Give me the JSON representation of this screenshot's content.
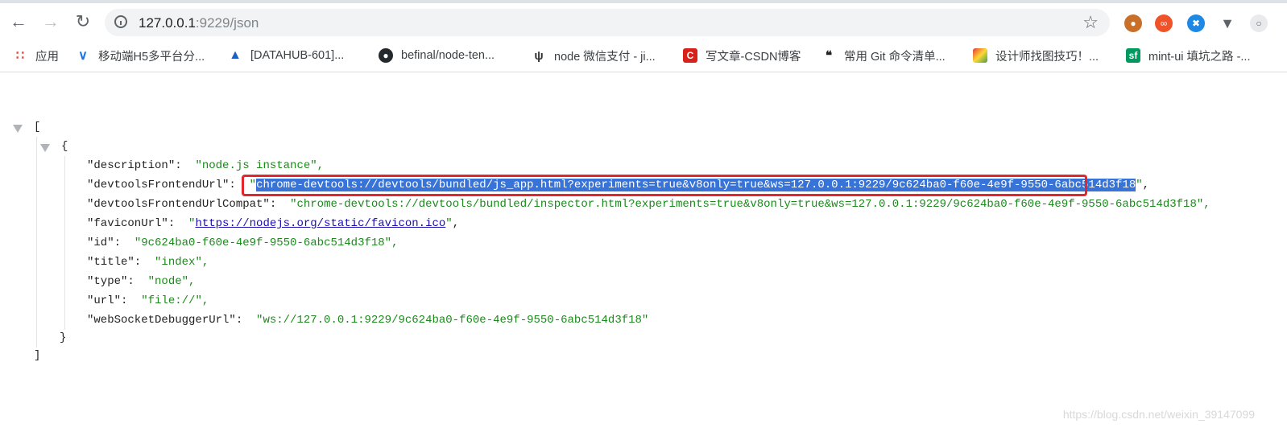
{
  "browser": {
    "url_host": "127.0.0.1",
    "url_rest": ":9229/json"
  },
  "bookmarks": [
    {
      "label": "应用",
      "icon": "apps-grid-icon"
    },
    {
      "label": "移动端H5多平台分...",
      "icon": "chevron-double-icon"
    },
    {
      "label": "[DATAHUB-601]...",
      "icon": "atlassian-icon"
    },
    {
      "label": "befinal/node-ten...",
      "icon": "github-icon"
    },
    {
      "label": "node 微信支付 - ji...",
      "icon": "jianshu-icon"
    },
    {
      "label": "写文章-CSDN博客",
      "icon": "csdn-icon"
    },
    {
      "label": "常用 Git 命令清单...",
      "icon": "calligraphy-icon"
    },
    {
      "label": "设计师找图技巧！...",
      "icon": "colorful-image-icon"
    },
    {
      "label": "mint-ui 填坑之路 -...",
      "icon": "segmentfault-icon"
    }
  ],
  "json_view": {
    "open_bracket": "[",
    "close_bracket": "]",
    "open_brace": "{",
    "close_brace": "}",
    "entries": [
      {
        "key": "\"description\":",
        "value": "\"node.js instance\",",
        "type": "str"
      },
      {
        "key": "\"devtoolsFrontendUrl\":",
        "value": "chrome-devtools://devtools/bundled/js_app.html?experiments=true&v8only=true&ws=127.0.0.1:9229/9c624ba0-f60e-4e9f-9550-6abc514d3f18",
        "type": "selected"
      },
      {
        "key": "\"devtoolsFrontendUrlCompat\":",
        "value": "\"chrome-devtools://devtools/bundled/inspector.html?experiments=true&v8only=true&ws=127.0.0.1:9229/9c624ba0-f60e-4e9f-9550-6abc514d3f18\",",
        "type": "str"
      },
      {
        "key": "\"faviconUrl\":",
        "value": "https://nodejs.org/static/favicon.ico",
        "type": "link"
      },
      {
        "key": "\"id\":",
        "value": "\"9c624ba0-f60e-4e9f-9550-6abc514d3f18\",",
        "type": "str"
      },
      {
        "key": "\"title\":",
        "value": "\"index\",",
        "type": "str"
      },
      {
        "key": "\"type\":",
        "value": "\"node\",",
        "type": "str"
      },
      {
        "key": "\"url\":",
        "value": "\"file://\",",
        "type": "str"
      },
      {
        "key": "\"webSocketDebuggerUrl\":",
        "value": "\"ws://127.0.0.1:9229/9c624ba0-f60e-4e9f-9550-6abc514d3f18\"",
        "type": "str"
      }
    ]
  },
  "watermark": "https://blog.csdn.net/weixin_39147099",
  "colors": {
    "accent_selection": "#3874d8",
    "highlight_border": "#e3262b",
    "string_green": "#1a8a1a"
  }
}
